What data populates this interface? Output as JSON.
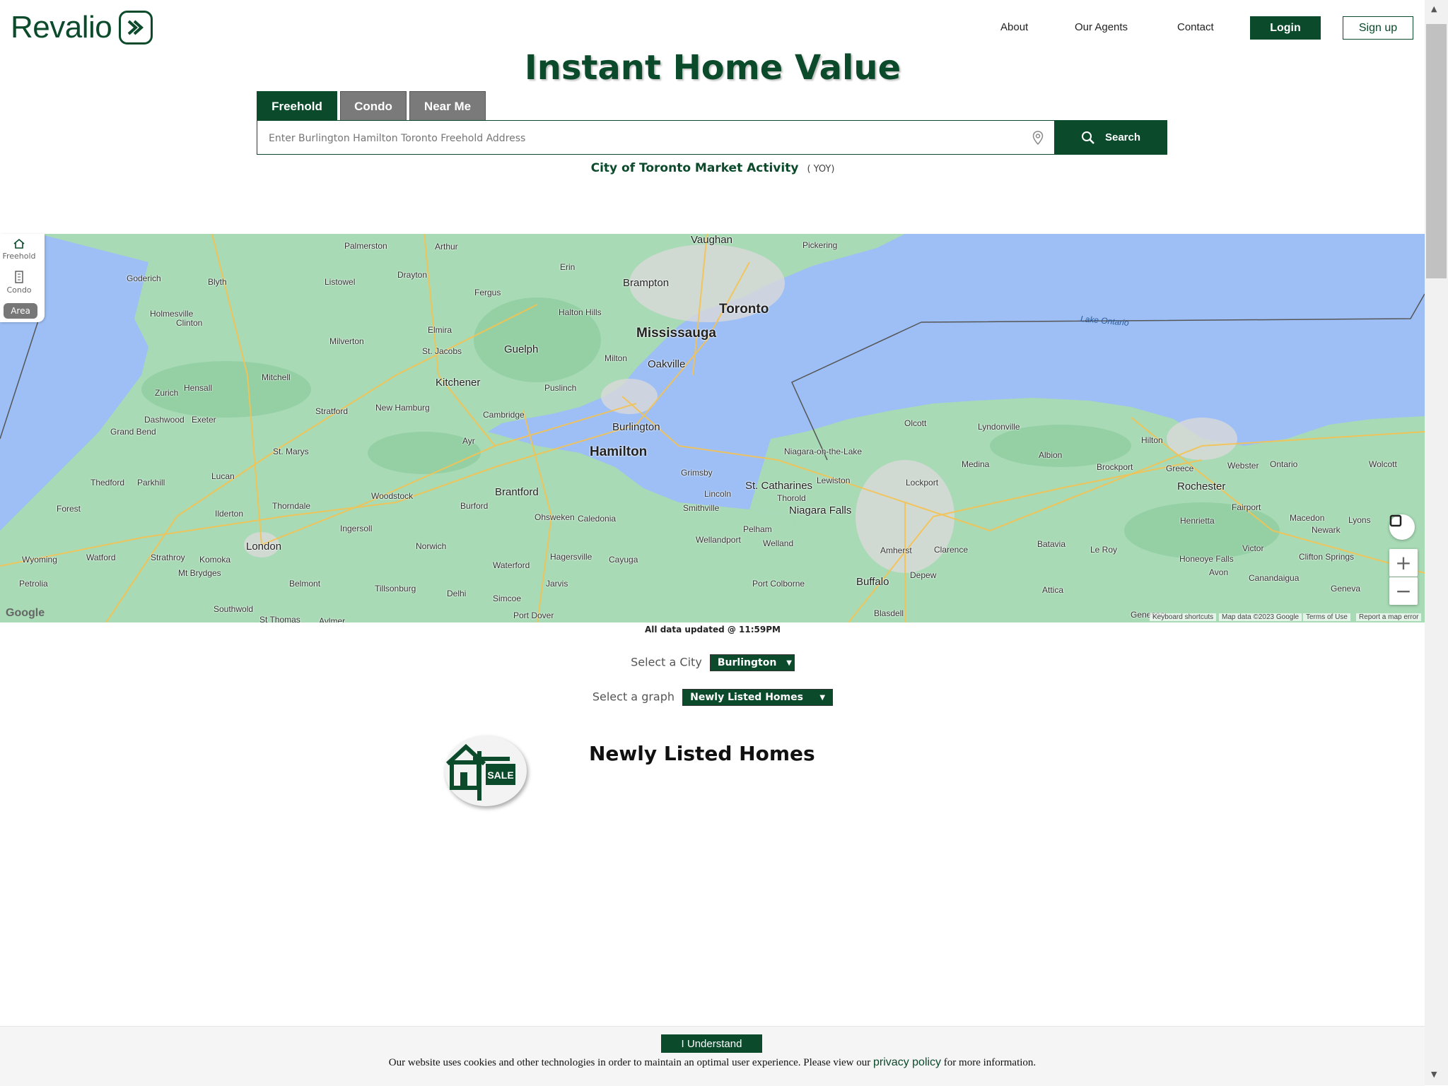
{
  "header": {
    "logo_text": "Revalio",
    "nav": [
      "About",
      "Our Agents",
      "Contact"
    ],
    "login": "Login",
    "signup": "Sign up"
  },
  "hero_title": "Instant Home Value",
  "tabs": [
    "Freehold",
    "Condo",
    "Near Me"
  ],
  "search": {
    "placeholder": "Enter Burlington Hamilton Toronto Freehold Address",
    "button": "Search"
  },
  "market": {
    "title": "City of Toronto Market Activity",
    "yoy": "( YOY)"
  },
  "rail": {
    "freehold": "Freehold",
    "condo": "Condo",
    "area": "Area"
  },
  "map": {
    "google": "Google",
    "attribution": {
      "shortcuts": "Keyboard shortcuts",
      "data": "Map data ©2023 Google",
      "terms": "Terms of Use",
      "report": "Report a map error"
    },
    "labels_big": [
      "Toronto",
      "Mississauga",
      "Hamilton"
    ],
    "labels_mid": [
      "Brampton",
      "Oakville",
      "Burlington",
      "Guelph",
      "Kitchener",
      "Brantford",
      "London",
      "St. Catharines",
      "Niagara Falls",
      "Buffalo",
      "Rochester",
      "Vaughan"
    ],
    "labels_small": [
      "Palmerston",
      "Arthur",
      "Pickering",
      "Goderich",
      "Blyth",
      "Listowel",
      "Drayton",
      "Erin",
      "Fergus",
      "Holmesville",
      "Clinton",
      "Halton Hills",
      "Elmira",
      "Milverton",
      "St. Jacobs",
      "Milton",
      "Mitchell",
      "Zurich",
      "Hensall",
      "Puslinch",
      "Stratford",
      "New Hamburg",
      "Cambridge",
      "Dashwood",
      "Exeter",
      "Grand Bend",
      "St. Marys",
      "Ayr",
      "Lucan",
      "Thedford",
      "Parkhill",
      "Grimsby",
      "Lincoln",
      "Forest",
      "Thorndale",
      "Woodstock",
      "Burford",
      "Smithville",
      "Ilderton",
      "Ingersoll",
      "Ohsweken",
      "Caledonia",
      "Wellandport",
      "Pelham",
      "Thorold",
      "Welland",
      "Watford",
      "Strathroy",
      "Komoka",
      "Norwich",
      "Hagersville",
      "Wyoming",
      "Mt Brydges",
      "Waterford",
      "Cayuga",
      "Petrolia",
      "Belmont",
      "Tillsonburg",
      "Jarvis",
      "Delhi",
      "Simcoe",
      "Port Colborne",
      "Southwold",
      "St Thomas",
      "Aylmer",
      "Port Dover",
      "Olcott",
      "Lyndonville",
      "Niagara-on-the-Lake",
      "Lewiston",
      "Medina",
      "Albion",
      "Hilton",
      "Brockport",
      "Greece",
      "Webster",
      "Ontario",
      "Wolcott",
      "Lockport",
      "Fairport",
      "Macedon",
      "Henrietta",
      "Lyons",
      "Newark",
      "Clarence",
      "Amherst",
      "Batavia",
      "Le Roy",
      "Victor",
      "Clifton Springs",
      "Depew",
      "Honeoye Falls",
      "Canandaigua",
      "Avon",
      "Geneva",
      "Attica",
      "Blasdell",
      "Geneseo"
    ],
    "lake": "Lake Ontario"
  },
  "updated": "All data updated @ 11:59PM",
  "select_city": {
    "label": "Select a City",
    "value": "Burlington"
  },
  "select_graph": {
    "label": "Select a graph",
    "value": "Newly Listed Homes"
  },
  "section_title": "Newly Listed Homes",
  "badge_text": "SALE",
  "cookie": {
    "button": "I Understand",
    "text_before": "Our website uses cookies and other technologies in order to maintain an optimal user experience. Please view our",
    "link": "privacy policy",
    "text_after": "for more information."
  },
  "colors": {
    "brand": "#0b4a2b",
    "land": "#a8dab5",
    "water": "#9dbff5"
  }
}
